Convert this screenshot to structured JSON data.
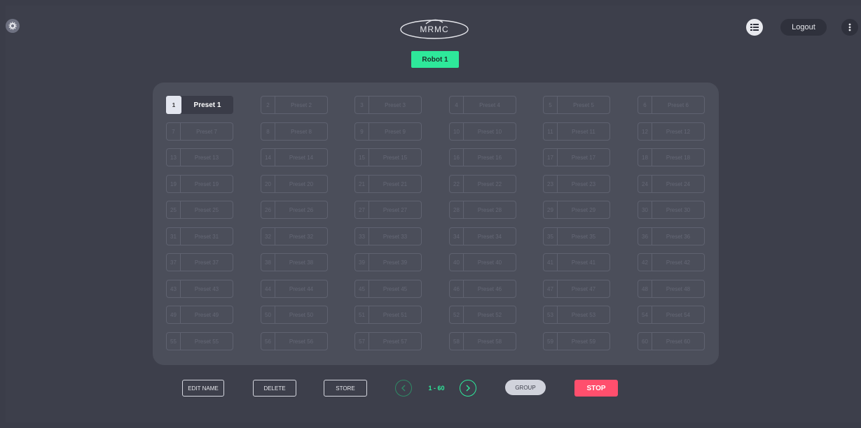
{
  "header": {
    "logo_text": "MRMC",
    "robot_button_label": "Robot 1",
    "logout_label": "Logout",
    "icons": {
      "settings": "gear-icon",
      "view": "grid-view-icon",
      "menu": "kebab-menu-icon"
    }
  },
  "presets": {
    "active_index": 0,
    "items": [
      {
        "num": "1",
        "label": "Preset 1"
      },
      {
        "num": "2",
        "label": "Preset 2"
      },
      {
        "num": "3",
        "label": "Preset 3"
      },
      {
        "num": "4",
        "label": "Preset 4"
      },
      {
        "num": "5",
        "label": "Preset 5"
      },
      {
        "num": "6",
        "label": "Preset 6"
      },
      {
        "num": "7",
        "label": "Preset 7"
      },
      {
        "num": "8",
        "label": "Preset 8"
      },
      {
        "num": "9",
        "label": "Preset 9"
      },
      {
        "num": "10",
        "label": "Preset 10"
      },
      {
        "num": "11",
        "label": "Preset 11"
      },
      {
        "num": "12",
        "label": "Preset 12"
      },
      {
        "num": "13",
        "label": "Preset 13"
      },
      {
        "num": "14",
        "label": "Preset 14"
      },
      {
        "num": "15",
        "label": "Preset 15"
      },
      {
        "num": "16",
        "label": "Preset 16"
      },
      {
        "num": "17",
        "label": "Preset 17"
      },
      {
        "num": "18",
        "label": "Preset 18"
      },
      {
        "num": "19",
        "label": "Preset 19"
      },
      {
        "num": "20",
        "label": "Preset 20"
      },
      {
        "num": "21",
        "label": "Preset 21"
      },
      {
        "num": "22",
        "label": "Preset 22"
      },
      {
        "num": "23",
        "label": "Preset 23"
      },
      {
        "num": "24",
        "label": "Preset 24"
      },
      {
        "num": "25",
        "label": "Preset 25"
      },
      {
        "num": "26",
        "label": "Preset 26"
      },
      {
        "num": "27",
        "label": "Preset 27"
      },
      {
        "num": "28",
        "label": "Preset 28"
      },
      {
        "num": "29",
        "label": "Preset 29"
      },
      {
        "num": "30",
        "label": "Preset 30"
      },
      {
        "num": "31",
        "label": "Preset 31"
      },
      {
        "num": "32",
        "label": "Preset 32"
      },
      {
        "num": "33",
        "label": "Preset 33"
      },
      {
        "num": "34",
        "label": "Preset 34"
      },
      {
        "num": "35",
        "label": "Preset 35"
      },
      {
        "num": "36",
        "label": "Preset 36"
      },
      {
        "num": "37",
        "label": "Preset 37"
      },
      {
        "num": "38",
        "label": "Preset 38"
      },
      {
        "num": "39",
        "label": "Preset 39"
      },
      {
        "num": "40",
        "label": "Preset 40"
      },
      {
        "num": "41",
        "label": "Preset 41"
      },
      {
        "num": "42",
        "label": "Preset 42"
      },
      {
        "num": "43",
        "label": "Preset 43"
      },
      {
        "num": "44",
        "label": "Preset 44"
      },
      {
        "num": "45",
        "label": "Preset 45"
      },
      {
        "num": "46",
        "label": "Preset 46"
      },
      {
        "num": "47",
        "label": "Preset 47"
      },
      {
        "num": "48",
        "label": "Preset 48"
      },
      {
        "num": "49",
        "label": "Preset 49"
      },
      {
        "num": "50",
        "label": "Preset 50"
      },
      {
        "num": "51",
        "label": "Preset 51"
      },
      {
        "num": "52",
        "label": "Preset 52"
      },
      {
        "num": "53",
        "label": "Preset 53"
      },
      {
        "num": "54",
        "label": "Preset 54"
      },
      {
        "num": "55",
        "label": "Preset 55"
      },
      {
        "num": "56",
        "label": "Preset 56"
      },
      {
        "num": "57",
        "label": "Preset 57"
      },
      {
        "num": "58",
        "label": "Preset 58"
      },
      {
        "num": "59",
        "label": "Preset 59"
      },
      {
        "num": "60",
        "label": "Preset 60"
      }
    ]
  },
  "toolbar": {
    "edit_name_label": "EDIT NAME",
    "delete_label": "DELETE",
    "store_label": "STORE",
    "page_range": "1 - 60",
    "group_label": "GROUP",
    "stop_label": "STOP"
  },
  "colors": {
    "background": "#3d3f4b",
    "panel": "#4b4e5a",
    "accent_green": "#2ee89a",
    "stop_red": "#ff4f6d"
  }
}
